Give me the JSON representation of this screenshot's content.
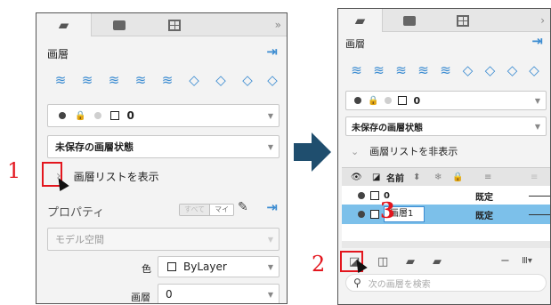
{
  "colors": {
    "accent": "#3a8bd1",
    "annotation_red": "#e3161e",
    "arrow": "#1f4e6e",
    "selection": "#7cc0ea"
  },
  "left": {
    "more_label": "»",
    "title": "画層",
    "layer_tool_icons": [
      "new-layer-icon",
      "layer-props-icon",
      "layer-state-icon",
      "match-layer-icon",
      "layer-isolate-icon",
      "layer-off-icon",
      "layer-freeze-icon",
      "layer-lock-icon",
      "layer-walk-icon"
    ],
    "current_layer": "0",
    "layer_state": "未保存の画層状態",
    "list_toggle_chevron": "›",
    "list_toggle_label": "画層リストを表示",
    "properties_title": "プロパティ",
    "seg_all": "すべて",
    "seg_mine": "マイ",
    "space_dropdown": "モデル空間",
    "color_label": "色",
    "color_value": "ByLayer",
    "layer_label": "画層",
    "layer_value": "0"
  },
  "right": {
    "more_label": "›",
    "title": "画層",
    "current_layer": "0",
    "layer_state": "未保存の画層状態",
    "list_toggle_chevron": "⌄",
    "list_toggle_label": "画層リストを非表示",
    "header_name": "名前",
    "header_sort": "⬍",
    "rows": [
      {
        "name": "0",
        "desc": "既定"
      },
      {
        "name": "画層1",
        "desc": "既定"
      }
    ],
    "search_placeholder": "次の画層を検索",
    "filter_label": "Ⅲ▾"
  },
  "annotations": {
    "one": "1",
    "two": "2",
    "three": "3"
  }
}
